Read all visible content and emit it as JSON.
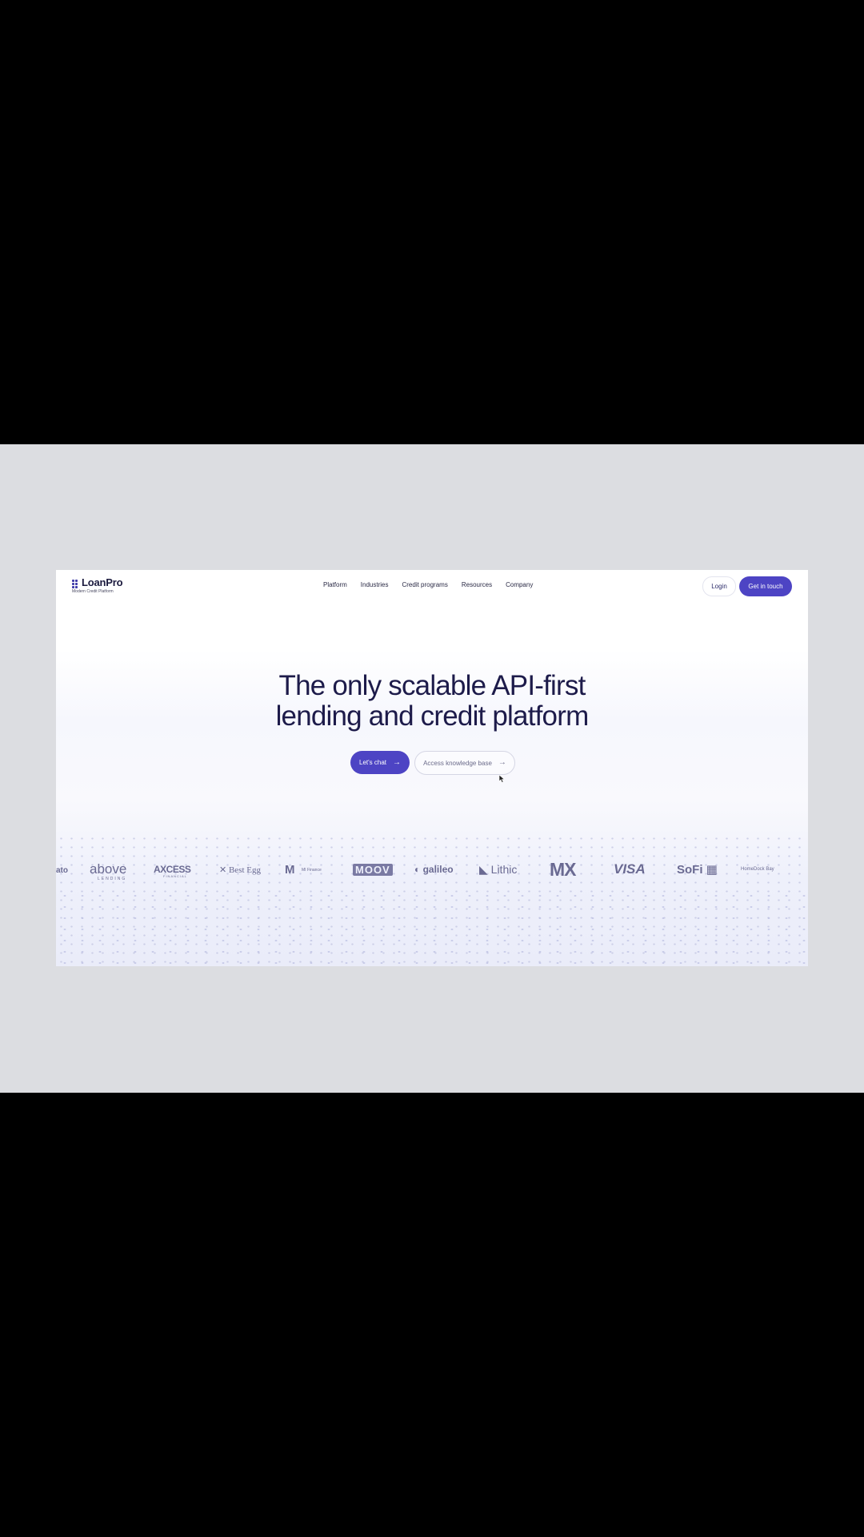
{
  "site": {
    "brand": {
      "name": "LoanPro",
      "tagline": "Modern Credit Platform"
    },
    "nav": [
      {
        "label": "Platform"
      },
      {
        "label": "Industries"
      },
      {
        "label": "Credit programs"
      },
      {
        "label": "Resources"
      },
      {
        "label": "Company"
      }
    ],
    "header_actions": {
      "login": "Login",
      "contact": "Get in touch"
    },
    "hero": {
      "title_line1": "The only scalable API-first",
      "title_line2": "lending and credit platform",
      "primary_cta": "Let's chat",
      "secondary_cta": "Access knowledge base",
      "arrow": "→"
    },
    "partner_logos": [
      "ato",
      "above",
      "LENDING",
      "AXCESS",
      "FINANCIAL",
      "Best Egg",
      "M",
      "MI Finance",
      "MOOV",
      "galileo",
      "Lithic",
      "MX",
      "VISA",
      "SoFi",
      "HomeDock Bay"
    ]
  },
  "colors": {
    "accent": "#4d44c4",
    "heading": "#1d1b4a",
    "logo_gray": "#6a6a92",
    "page_backdrop": "#dcdde1"
  },
  "icons": [
    "loanpro-logo-icon",
    "arrow-right-icon",
    "mouse-cursor-icon"
  ]
}
